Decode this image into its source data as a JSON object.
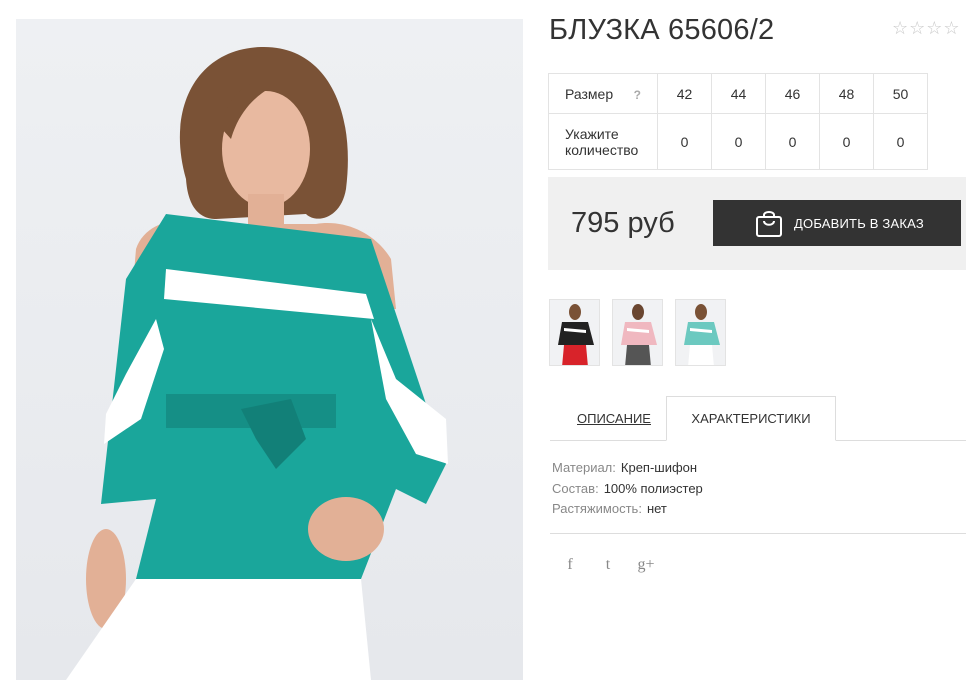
{
  "product": {
    "title": "БЛУЗКА 65606/2",
    "rating_stars": [
      "☆",
      "☆",
      "☆",
      "☆"
    ],
    "rating_value": 0
  },
  "size_table": {
    "size_label": "Размер",
    "help": "?",
    "qty_label": "Укажите количество",
    "sizes": [
      "42",
      "44",
      "46",
      "48",
      "50"
    ],
    "quantities": [
      "0",
      "0",
      "0",
      "0",
      "0"
    ]
  },
  "purchase": {
    "price": "795 руб",
    "add_button": "ДОБАВИТЬ В ЗАКАЗ"
  },
  "tabs": {
    "description": "ОПИСАНИЕ",
    "characteristics": "ХАРАКТЕРИСТИКИ"
  },
  "specs": [
    {
      "key": "Материал:",
      "value": "Креп-шифон"
    },
    {
      "key": "Состав:",
      "value": "100% полиэстер"
    },
    {
      "key": "Растяжимость:",
      "value": "нет"
    }
  ],
  "social": {
    "facebook": "f",
    "twitter": "t",
    "google": "g+"
  },
  "colors": {
    "blouse": "#1aa69b",
    "accent_dark": "#333333",
    "panel": "#f0f0f0"
  }
}
